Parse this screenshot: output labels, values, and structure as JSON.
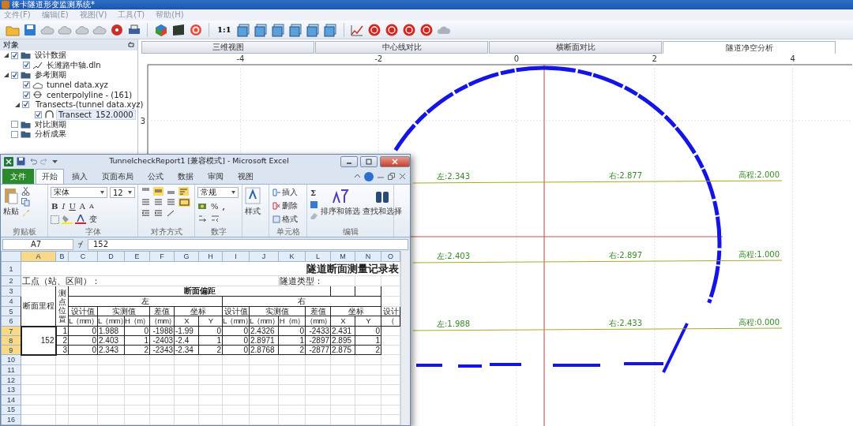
{
  "app": {
    "title": "徕卡隧道形变监测系统*",
    "menu": [
      "文件(F)",
      "编辑(E)",
      "视图(V)",
      "工具(T)",
      "帮助(H)"
    ],
    "toolbar_text": "1:1"
  },
  "object_panel": {
    "title": "对象",
    "tree": [
      {
        "label": "设计数据",
        "kind": "folder",
        "checked": true,
        "expanded": true,
        "selected": false,
        "children": [
          {
            "label": "长潍路中轴.dln",
            "kind": "line",
            "checked": true,
            "expanded": false,
            "selected": false
          }
        ]
      },
      {
        "label": "参考测期",
        "kind": "folder",
        "checked": true,
        "expanded": true,
        "selected": false,
        "children": [
          {
            "label": "tunnel data.xyz",
            "kind": "cloud",
            "checked": true,
            "expanded": false,
            "selected": false
          },
          {
            "label": "centerpolyline - (161)",
            "kind": "polyline",
            "checked": true,
            "expanded": false,
            "selected": false
          },
          {
            "label": "Transects-(tunnel data.xyz)",
            "kind": "folder",
            "checked": true,
            "expanded": true,
            "selected": false,
            "children": [
              {
                "label": "Transect_152.0000",
                "kind": "transect",
                "checked": true,
                "expanded": false,
                "selected": true
              }
            ]
          }
        ]
      },
      {
        "label": "对比测期",
        "kind": "folder",
        "checked": false,
        "expanded": false,
        "selected": false
      },
      {
        "label": "分析成果",
        "kind": "folder",
        "checked": false,
        "expanded": false,
        "selected": false
      }
    ]
  },
  "view_tabs": [
    {
      "label": "三维视图",
      "selected": false
    },
    {
      "label": "中心线对比",
      "selected": false
    },
    {
      "label": "横断面对比",
      "selected": false
    },
    {
      "label": "隧道净空分析",
      "selected": true
    }
  ],
  "plot": {
    "x_ticks": [
      "-4",
      "-2",
      "0",
      "2",
      "4"
    ],
    "y_ticks": [
      "3"
    ],
    "clearance_lines": [
      {
        "left_label": "左:2.343",
        "right_label": "右:2.877",
        "elevation_label": "高程:2.000"
      },
      {
        "left_label": "左:2.403",
        "right_label": "右:2.897",
        "elevation_label": "高程:1.000"
      },
      {
        "left_label": "左:1.988",
        "right_label": "右:2.433",
        "elevation_label": "高程:0.000"
      }
    ]
  },
  "excel": {
    "title": "TunnelcheckReport1  [兼容模式] - Microsoft Excel",
    "tabs": [
      {
        "label": "文件",
        "kind": "file",
        "selected": false
      },
      {
        "label": "开始",
        "kind": "tab",
        "selected": true
      },
      {
        "label": "插入",
        "kind": "tab",
        "selected": false
      },
      {
        "label": "页面布局",
        "kind": "tab",
        "selected": false
      },
      {
        "label": "公式",
        "kind": "tab",
        "selected": false
      },
      {
        "label": "数据",
        "kind": "tab",
        "selected": false
      },
      {
        "label": "审阅",
        "kind": "tab",
        "selected": false
      },
      {
        "label": "视图",
        "kind": "tab",
        "selected": false
      }
    ],
    "ribbon": {
      "paste": "粘贴",
      "font_name": "宋体",
      "font_size": "12",
      "font_buttons": [
        "B",
        "I",
        "U",
        "A",
        "A"
      ],
      "phonetic": "变",
      "number_format": "常规",
      "percent": "%",
      "comma": ",",
      "styles": "样式",
      "insert": "插入",
      "delete": "删除",
      "format": "格式",
      "sum": "Σ",
      "sort": "排序和筛选",
      "find": "查找和选择",
      "groups": [
        "剪贴板",
        "字体",
        "对齐方式",
        "数字",
        "单元格",
        "编辑"
      ]
    },
    "name_box": "A7",
    "formula": "152",
    "columns": [
      {
        "label": "A",
        "selected": true
      },
      {
        "label": "B",
        "selected": false
      },
      {
        "label": "C",
        "selected": false
      },
      {
        "label": "D",
        "selected": false
      },
      {
        "label": "E",
        "selected": false
      },
      {
        "label": "F",
        "selected": false
      },
      {
        "label": "G",
        "selected": false
      },
      {
        "label": "H",
        "selected": false
      },
      {
        "label": "I",
        "selected": false
      },
      {
        "label": "J",
        "selected": false
      },
      {
        "label": "K",
        "selected": false
      },
      {
        "label": "L",
        "selected": false
      },
      {
        "label": "M",
        "selected": false
      },
      {
        "label": "N",
        "selected": false
      },
      {
        "label": "O",
        "selected": false
      }
    ],
    "rows": [
      {
        "label": "1",
        "selected": false
      },
      {
        "label": "2",
        "selected": false
      },
      {
        "label": "3",
        "selected": false
      },
      {
        "label": "4",
        "selected": false
      },
      {
        "label": "5",
        "selected": false
      },
      {
        "label": "6",
        "selected": false
      },
      {
        "label": "7",
        "selected": true
      },
      {
        "label": "8",
        "selected": true
      },
      {
        "label": "9",
        "selected": true
      },
      {
        "label": "10",
        "selected": false
      },
      {
        "label": "11",
        "selected": false
      },
      {
        "label": "12",
        "selected": false
      },
      {
        "label": "13",
        "selected": false
      },
      {
        "label": "14",
        "selected": false
      },
      {
        "label": "15",
        "selected": false
      },
      {
        "label": "16",
        "selected": false
      }
    ],
    "sheet": {
      "title": "隧道断面测量记录表",
      "site_label": "工点（站、区间）：",
      "type_label": "隧道类型：",
      "station_header": "断面里程",
      "point_header": "测点位置",
      "offset_header": "断面偏距",
      "left": "左",
      "right": "右",
      "sub_headers": [
        "设计值",
        "实测值",
        "差值",
        "坐标",
        "设计值",
        "实测值",
        "差值",
        "坐标",
        "设计"
      ],
      "units": [
        "L（mm）",
        "L（mm）",
        "H（m）",
        "（mm）",
        "X",
        "Y",
        "L（mm）",
        "L（mm）",
        "H（m）",
        "（mm）",
        "X",
        "Y",
        "（"
      ],
      "station": "152",
      "points": [
        {
          "point": "1",
          "values": [
            "0",
            "1.988",
            "0",
            "-1988",
            "-1.99",
            "0",
            "0",
            "2.4326",
            "0",
            "-2433",
            "2.431",
            "0"
          ]
        },
        {
          "point": "2",
          "values": [
            "0",
            "2.403",
            "1",
            "-2403",
            "-2.4",
            "1",
            "0",
            "2.8971",
            "1",
            "-2897",
            "2.895",
            "1"
          ]
        },
        {
          "point": "3",
          "values": [
            "0",
            "2.343",
            "2",
            "-2343",
            "-2.34",
            "2",
            "0",
            "2.8768",
            "2",
            "-2877",
            "2.875",
            "2"
          ]
        }
      ]
    }
  }
}
